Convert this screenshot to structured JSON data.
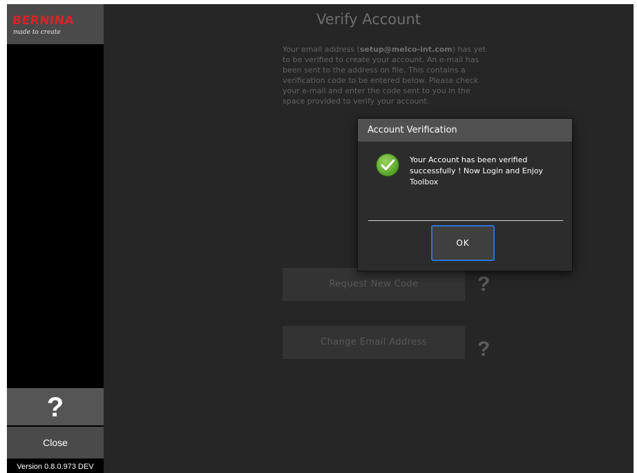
{
  "sidebar": {
    "logo": {
      "brand": "BERNINA",
      "tagline": "made to create",
      "brand_color": "#d8232a"
    },
    "help_label": "?",
    "close_label": "Close",
    "version": "Version 0.8.0.973 DEV"
  },
  "main": {
    "title": "Verify Account",
    "description": {
      "before_email": "Your email address (",
      "email": "setup@melco-int.com",
      "after_email": ") has yet to be verified to create your account. An e-mail has been sent to the address on file. This contains a verification code to be entered below. Please check your e-mail and enter the code sent to you in the space provided to verify your account."
    },
    "request_code_label": "Request New Code",
    "change_email_label": "Change Email Address",
    "help_mark": "?"
  },
  "dialog": {
    "title": "Account Verification",
    "icon": "checkmark-circle-icon",
    "icon_color": "#5dab2f",
    "message": "Your Account has been verified successfully ! Now Login and Enjoy Toolbox",
    "ok_label": "OK",
    "focus_color": "#2f74d0"
  }
}
